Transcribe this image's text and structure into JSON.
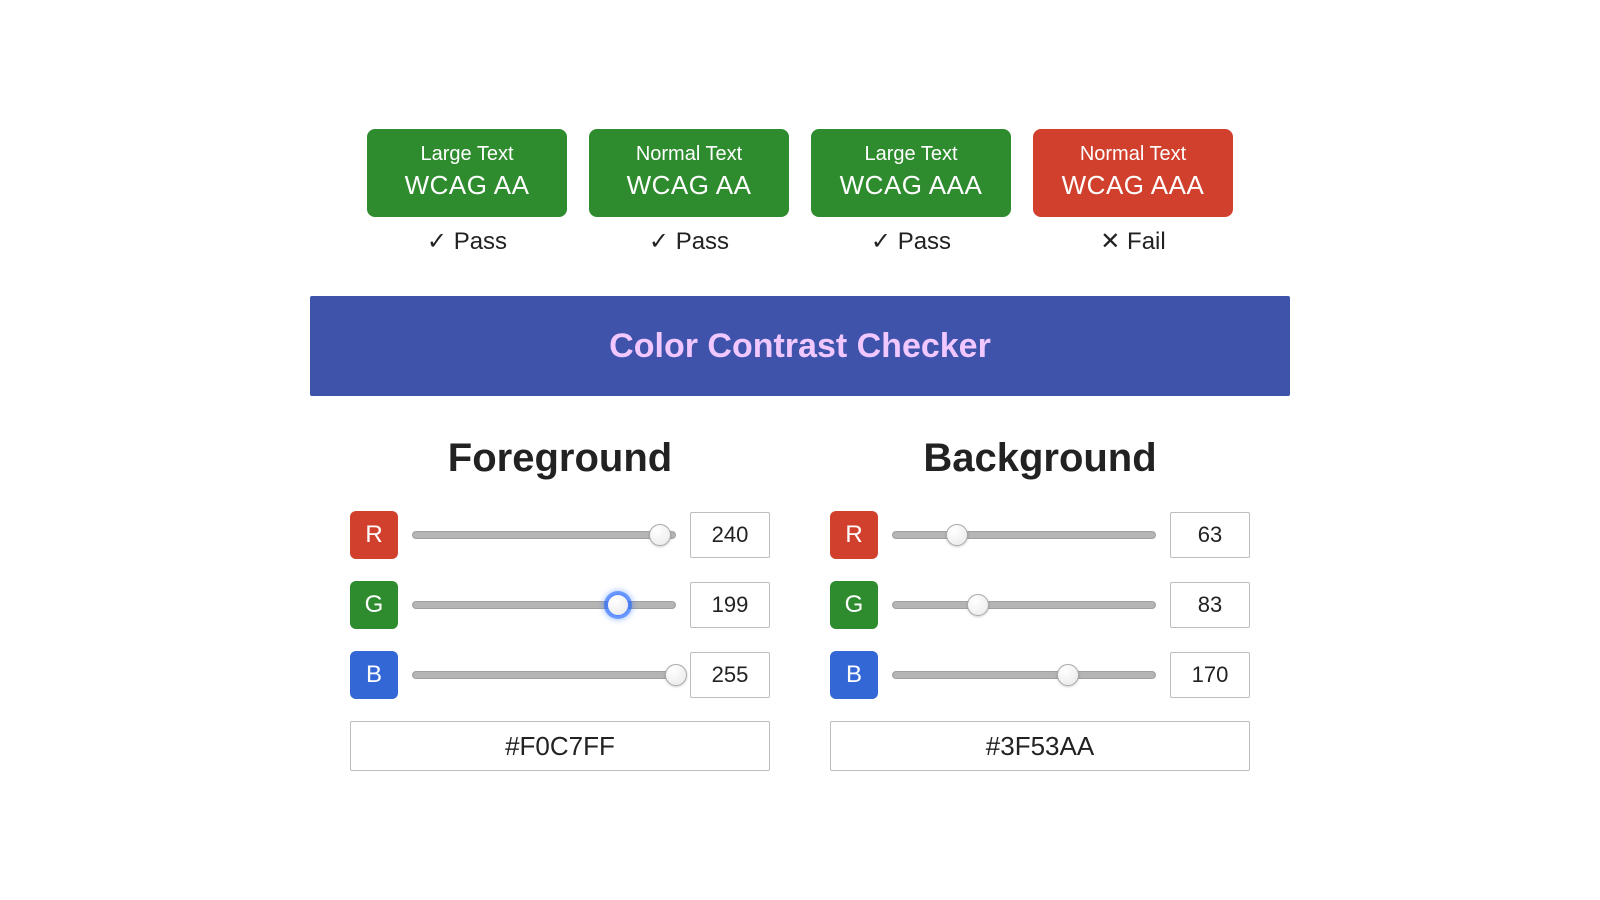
{
  "results": [
    {
      "text_size": "Large Text",
      "level": "WCAG AA",
      "status": "pass",
      "verdict": "✓ Pass"
    },
    {
      "text_size": "Normal Text",
      "level": "WCAG AA",
      "status": "pass",
      "verdict": "✓ Pass"
    },
    {
      "text_size": "Large Text",
      "level": "WCAG AAA",
      "status": "pass",
      "verdict": "✓ Pass"
    },
    {
      "text_size": "Normal Text",
      "level": "WCAG AAA",
      "status": "fail",
      "verdict": "✕ Fail"
    }
  ],
  "preview": {
    "text": "Color Contrast Checker",
    "fg": "#F0C7FF",
    "bg": "#3F53AA"
  },
  "foreground": {
    "title": "Foreground",
    "r": {
      "label": "R",
      "value": 240
    },
    "g": {
      "label": "G",
      "value": 199,
      "focused": true
    },
    "b": {
      "label": "B",
      "value": 255
    },
    "hex": "#F0C7FF"
  },
  "background": {
    "title": "Background",
    "r": {
      "label": "R",
      "value": 63
    },
    "g": {
      "label": "G",
      "value": 83
    },
    "b": {
      "label": "B",
      "value": 170
    },
    "hex": "#3F53AA"
  },
  "slider_max": 255
}
